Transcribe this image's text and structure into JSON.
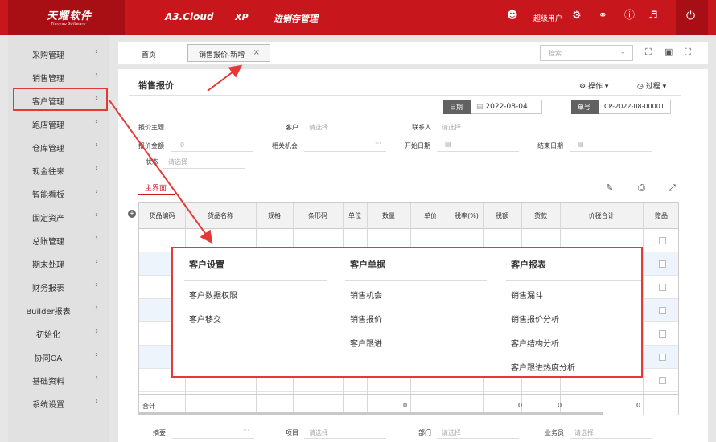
{
  "topbar": {
    "logo_cn": "天耀软件",
    "logo_en": "Tianyao Software",
    "brand": "A3.Cloud",
    "edition": "XP",
    "module": "进销存管理",
    "user": "超级用户",
    "icons": [
      "user-icon",
      "gear-icon",
      "chat-icon",
      "help-icon",
      "speaker-icon",
      "power-icon"
    ]
  },
  "sidebar": {
    "items": [
      {
        "label": "采购管理"
      },
      {
        "label": "销售管理"
      },
      {
        "label": "客户管理"
      },
      {
        "label": "跑店管理"
      },
      {
        "label": "仓库管理"
      },
      {
        "label": "现金往来"
      },
      {
        "label": "智能看板"
      },
      {
        "label": "固定资产"
      },
      {
        "label": "总账管理"
      },
      {
        "label": "期末处理"
      },
      {
        "label": "财务报表"
      },
      {
        "label": "Builder报表"
      },
      {
        "label": "初始化"
      },
      {
        "label": "协同OA"
      },
      {
        "label": "基础资料"
      },
      {
        "label": "系统设置"
      }
    ]
  },
  "tabs": {
    "home": "首页",
    "active": "销售报价-新增"
  },
  "search": {
    "placeholder": "搜索"
  },
  "page": {
    "title": "销售报价",
    "op_label": "操作",
    "process_label": "过程",
    "date_tag": "日期",
    "date_value": "2022-08-04",
    "no_tag": "单号",
    "no_value": "CP-2022-08-00001"
  },
  "form": {
    "subject_label": "报价主题",
    "customer_label": "客户",
    "customer_ph": "请选择",
    "contact_label": "联系人",
    "contact_ph": "请选择",
    "amount_label": "报价金额",
    "amount_value": "0",
    "opportunity_label": "相关机会",
    "start_label": "开始日期",
    "end_label": "结束日期",
    "status_label": "状态",
    "status_ph": "请选择"
  },
  "main_tab": "主界面",
  "grid": {
    "headers": [
      "货品编码",
      "货品名称",
      "规格",
      "条形码",
      "单位",
      "数量",
      "单价",
      "税率(%)",
      "税额",
      "货款",
      "价税合计",
      "赠品"
    ],
    "sum_label": "合计",
    "sums": [
      "0",
      "0",
      "0",
      "0"
    ]
  },
  "popup": {
    "columns": [
      {
        "title": "客户设置",
        "items": [
          "客户数据权限",
          "客户移交"
        ]
      },
      {
        "title": "客户单据",
        "items": [
          "销售机会",
          "销售报价",
          "客户跟进"
        ]
      },
      {
        "title": "客户报表",
        "items": [
          "销售漏斗",
          "销售报价分析",
          "客户结构分析",
          "客户跟进热度分析"
        ]
      }
    ]
  },
  "bottom": {
    "summary_label": "摘要",
    "project_label": "项目",
    "project_ph": "请选择",
    "dept_label": "部门",
    "dept_ph": "请选择",
    "sales_label": "业务员",
    "sales_ph": "请选择"
  },
  "colors": {
    "brand_red": "#c8161d",
    "highlight": "#e53935"
  }
}
